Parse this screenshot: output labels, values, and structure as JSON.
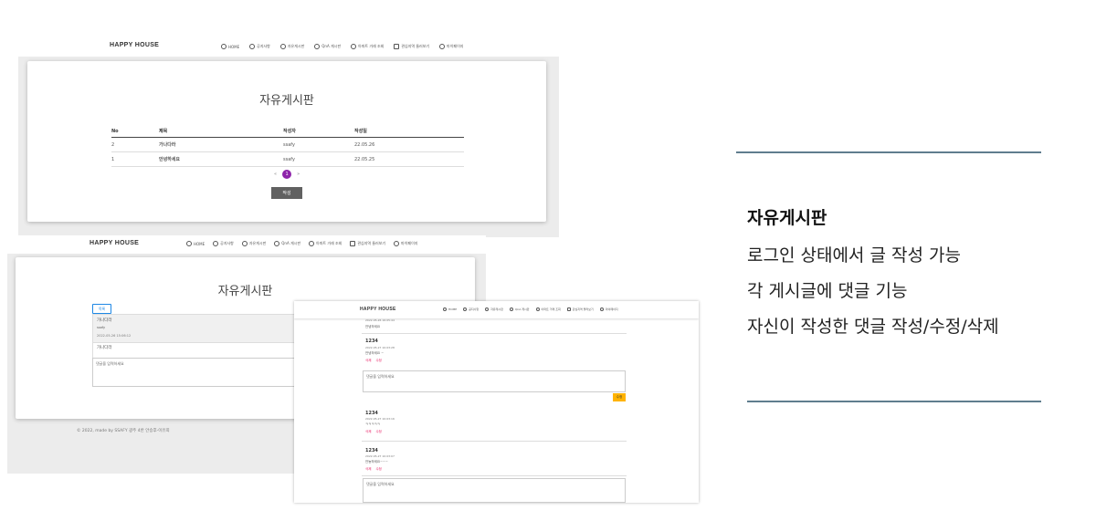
{
  "nav": {
    "brand": "HAPPY HOUSE",
    "items": [
      {
        "icon": "home-icon",
        "label": "HOME"
      },
      {
        "icon": "info-icon",
        "label": "공지사항"
      },
      {
        "icon": "chat-icon",
        "label": "자유게시판"
      },
      {
        "icon": "question-icon",
        "label": "QnA 게시판"
      },
      {
        "icon": "dollar-icon",
        "label": "아파트 거래 조회"
      },
      {
        "icon": "bookmark-icon",
        "label": "관심지역 둘러보기"
      },
      {
        "icon": "user-icon",
        "label": "마이페이지"
      }
    ]
  },
  "screen1": {
    "title": "자유게시판",
    "columns": [
      "No",
      "제목",
      "작성자",
      "작성일"
    ],
    "rows": [
      {
        "no": "2",
        "title": "가나다라",
        "author": "ssafy",
        "date": "22.05.26"
      },
      {
        "no": "1",
        "title": "안녕하세요",
        "author": "ssafy",
        "date": "22.05.25"
      }
    ],
    "pagination": {
      "prev": "«",
      "current": "1",
      "next": "»"
    },
    "write_button": "작성"
  },
  "screen2": {
    "title": "자유게시판",
    "list_button": "목록",
    "post_title": "가나다라",
    "post_author": "ssafy",
    "post_date": "2022-05-26 15:06:12",
    "post_content": "가나다라",
    "comment_placeholder": "댓글을 입력하세요",
    "footer": "© 2022, made by SSAFY 광주 4반 안승후-이유희"
  },
  "screen3": {
    "top_date": "2022-05-26 16:05:44",
    "top_text": "안녕하세요",
    "comments": [
      {
        "name": "1234",
        "date": "2022-05-27 10:03:28",
        "text": "안녕하세요 ~",
        "actions": [
          "삭제",
          "수정"
        ]
      },
      {
        "name": "1234",
        "date": "2022-05-27 10:03:16",
        "text": "ㅋㅋㅋㅋㅋ",
        "actions": [
          "삭제",
          "수정"
        ]
      },
      {
        "name": "1234",
        "date": "2022-05-27 10:03:07",
        "text": "안뇽하세요~~~",
        "actions": [
          "삭제",
          "수정"
        ]
      }
    ],
    "edit_placeholder": "댓글을 입력하세요",
    "edit_button": "수정",
    "new_placeholder": "댓글을 입력하세요"
  },
  "description": {
    "title": "자유게시판",
    "lines": [
      "로그인 상태에서 글 작성 가능",
      "각 게시글에 댓글 기능",
      "자신이 작성한 댓글 작성/수정/삭제"
    ]
  },
  "colors": {
    "accent_purple": "#8e24aa",
    "link_purple": "#7b1fa2",
    "rule": "#5f7d8e",
    "amber": "#ffb300"
  }
}
